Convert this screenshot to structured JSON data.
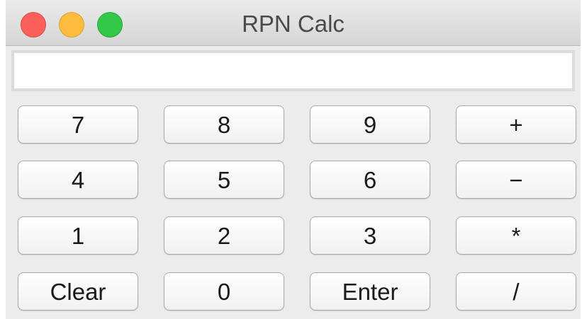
{
  "window": {
    "title": "RPN Calc",
    "controls": {
      "close_color": "#fc605b",
      "minimize_color": "#fdbc40",
      "zoom_color": "#34c84a"
    }
  },
  "display": {
    "value": ""
  },
  "keypad": {
    "rows": [
      [
        "7",
        "8",
        "9",
        "+"
      ],
      [
        "4",
        "5",
        "6",
        "−"
      ],
      [
        "1",
        "2",
        "3",
        "*"
      ],
      [
        "Clear",
        "0",
        "Enter",
        "/"
      ]
    ]
  }
}
